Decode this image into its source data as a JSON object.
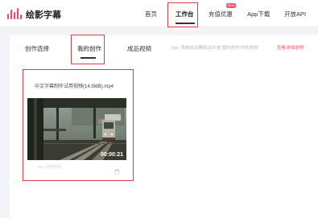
{
  "app": {
    "brand_name": "绘影字幕"
  },
  "nav": {
    "items": [
      {
        "label": "首页"
      },
      {
        "label": "工作台"
      },
      {
        "label": "充值优惠"
      },
      {
        "label": "App下载"
      },
      {
        "label": "开放API"
      }
    ],
    "active_index": 1,
    "badge": "NEW"
  },
  "tabs": {
    "items": [
      {
        "label": "创作选择"
      },
      {
        "label": "我的创作"
      },
      {
        "label": "成品视频"
      }
    ],
    "active_index": 1
  },
  "tips": {
    "text": "tips: 系统自动删除30天前'我的创作'中的视频",
    "link": "查看详细说明"
  },
  "video": {
    "title": "中文字幕制作试用视频(14.5MB).mp4",
    "duration": "00:00:21",
    "meta": "tips·试用视频"
  },
  "colors": {
    "accent": "#ff4d6d",
    "highlight_box": "#e23a43"
  },
  "icons": {
    "logo": "sound-wave-logo-icon",
    "delete": "trash-icon"
  }
}
